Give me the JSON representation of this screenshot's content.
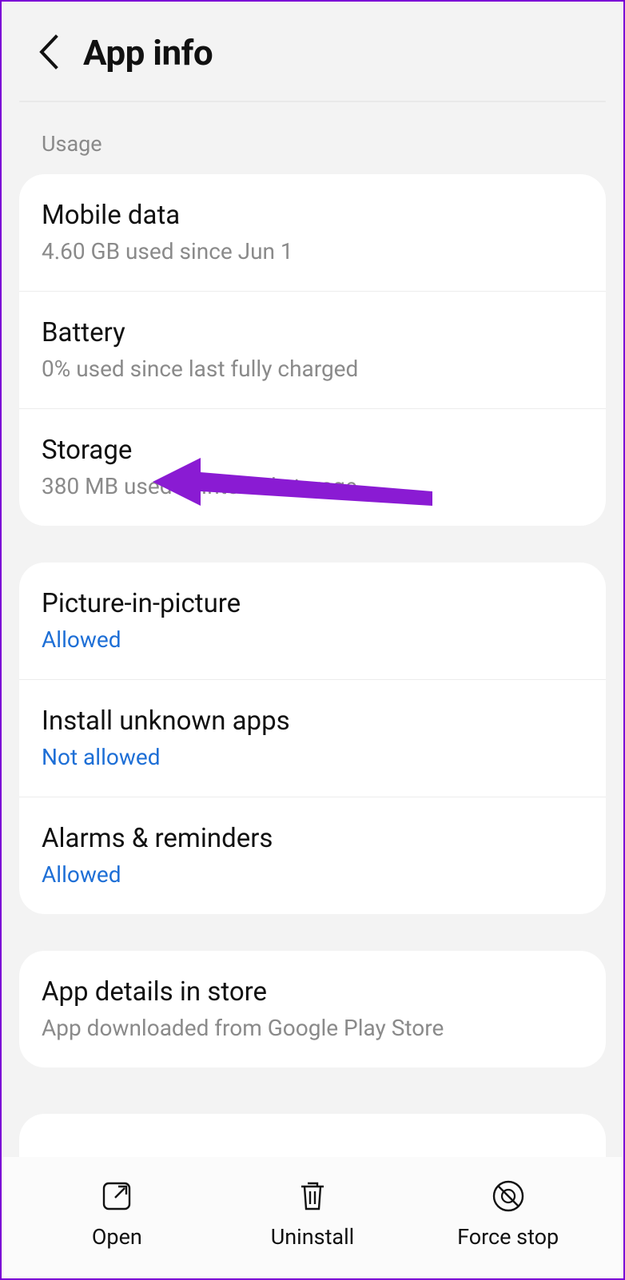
{
  "header": {
    "title": "App info"
  },
  "usage_section": {
    "label": "Usage",
    "items": [
      {
        "title": "Mobile data",
        "subtitle": "4.60 GB used since Jun 1"
      },
      {
        "title": "Battery",
        "subtitle": "0% used since last fully charged"
      },
      {
        "title": "Storage",
        "subtitle": "380 MB used in Internal storage"
      }
    ]
  },
  "permissions_section": {
    "items": [
      {
        "title": "Picture-in-picture",
        "status": "Allowed"
      },
      {
        "title": "Install unknown apps",
        "status": "Not allowed"
      },
      {
        "title": "Alarms & reminders",
        "status": "Allowed"
      }
    ]
  },
  "store_section": {
    "items": [
      {
        "title": "App details in store",
        "subtitle": "App downloaded from Google Play Store"
      }
    ]
  },
  "bottom_bar": {
    "open": "Open",
    "uninstall": "Uninstall",
    "force_stop": "Force stop"
  },
  "annotation": {
    "color": "#8a1bd3"
  }
}
